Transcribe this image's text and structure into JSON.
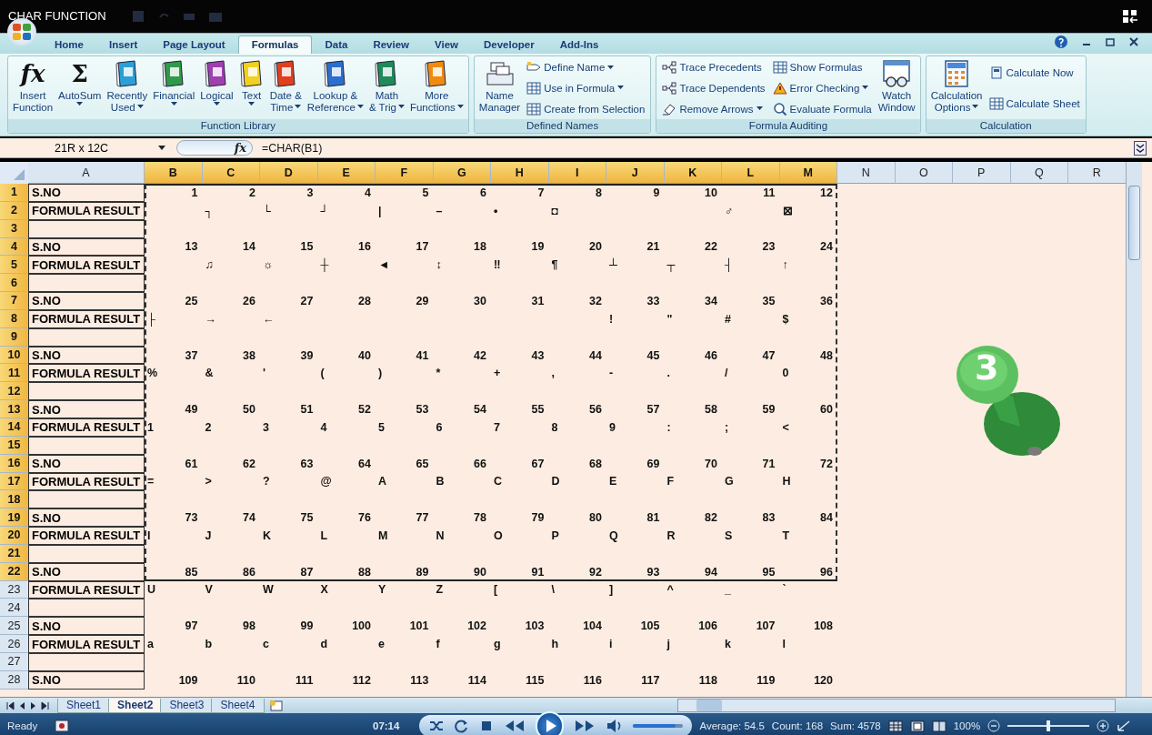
{
  "window": {
    "title": "CHAR FUNCTION"
  },
  "ribbon": {
    "tabs": [
      {
        "label": "Home",
        "selected": false
      },
      {
        "label": "Insert",
        "selected": false
      },
      {
        "label": "Page Layout",
        "selected": false
      },
      {
        "label": "Formulas",
        "selected": true
      },
      {
        "label": "Data",
        "selected": false
      },
      {
        "label": "Review",
        "selected": false
      },
      {
        "label": "View",
        "selected": false
      },
      {
        "label": "Developer",
        "selected": false
      },
      {
        "label": "Add-Ins",
        "selected": false
      }
    ],
    "groups": [
      {
        "label": "Function Library",
        "items": [
          {
            "kind": "large",
            "glyph": "fx",
            "lines": [
              "Insert",
              "Function"
            ],
            "dropdown": false
          },
          {
            "kind": "large",
            "glyph": "Σ",
            "lines": [
              "AutoSum"
            ],
            "dropdown": true
          },
          {
            "kind": "large",
            "lines": [
              "Recently",
              "Used"
            ],
            "dropdown": true
          },
          {
            "kind": "large",
            "lines": [
              "Financial"
            ],
            "dropdown": true
          },
          {
            "kind": "large",
            "lines": [
              "Logical"
            ],
            "dropdown": true
          },
          {
            "kind": "large",
            "lines": [
              "Text"
            ],
            "dropdown": true
          },
          {
            "kind": "large",
            "lines": [
              "Date &",
              "Time"
            ],
            "dropdown": true
          },
          {
            "kind": "large",
            "lines": [
              "Lookup &",
              "Reference"
            ],
            "dropdown": true
          },
          {
            "kind": "large",
            "lines": [
              "Math",
              "& Trig"
            ],
            "dropdown": true
          },
          {
            "kind": "large",
            "lines": [
              "More",
              "Functions"
            ],
            "dropdown": true
          }
        ]
      },
      {
        "label": "Defined Names",
        "items": [
          {
            "kind": "large",
            "lines": [
              "Name",
              "Manager"
            ],
            "dropdown": false
          },
          {
            "kind": "stack",
            "items": [
              {
                "label": "Define Name",
                "dropdown": true
              },
              {
                "label": "Use in Formula",
                "dropdown": true
              },
              {
                "label": "Create from Selection",
                "dropdown": false
              }
            ]
          }
        ]
      },
      {
        "label": "Formula Auditing",
        "items": [
          {
            "kind": "stack",
            "items": [
              {
                "label": "Trace Precedents",
                "dropdown": false
              },
              {
                "label": "Trace Dependents",
                "dropdown": false
              },
              {
                "label": "Remove Arrows",
                "dropdown": true
              }
            ]
          },
          {
            "kind": "stack",
            "items": [
              {
                "label": "Show Formulas",
                "dropdown": false
              },
              {
                "label": "Error Checking",
                "dropdown": true
              },
              {
                "label": "Evaluate Formula",
                "dropdown": false
              }
            ]
          },
          {
            "kind": "large",
            "lines": [
              "Watch",
              "Window"
            ],
            "dropdown": false
          }
        ]
      },
      {
        "label": "Calculation",
        "items": [
          {
            "kind": "large",
            "lines": [
              "Calculation",
              "Options"
            ],
            "dropdown": true
          },
          {
            "kind": "stack",
            "items": [
              {
                "label": "Calculate Now",
                "dropdown": false
              },
              {
                "label": "Calculate Sheet",
                "dropdown": false
              }
            ]
          }
        ]
      }
    ]
  },
  "formula_bar": {
    "name_box": "21R x 12C",
    "function_label": "fx",
    "formula": "=CHAR(B1)"
  },
  "sheet": {
    "columns": [
      {
        "label": "A",
        "selected": false
      },
      {
        "label": "B",
        "selected": true
      },
      {
        "label": "C",
        "selected": true
      },
      {
        "label": "D",
        "selected": true
      },
      {
        "label": "E",
        "selected": true
      },
      {
        "label": "F",
        "selected": true
      },
      {
        "label": "G",
        "selected": true
      },
      {
        "label": "H",
        "selected": true
      },
      {
        "label": "I",
        "selected": true
      },
      {
        "label": "J",
        "selected": true
      },
      {
        "label": "K",
        "selected": true
      },
      {
        "label": "L",
        "selected": true
      },
      {
        "label": "M",
        "selected": true
      },
      {
        "label": "N",
        "selected": false
      },
      {
        "label": "O",
        "selected": false
      },
      {
        "label": "P",
        "selected": false
      },
      {
        "label": "Q",
        "selected": false
      },
      {
        "label": "R",
        "selected": false
      }
    ],
    "rows": [
      {
        "header": "1",
        "selected": true,
        "kind": "number",
        "label": "S.NO",
        "values": [
          "1",
          "2",
          "3",
          "4",
          "5",
          "6",
          "7",
          "8",
          "9",
          "10",
          "11",
          "12"
        ]
      },
      {
        "header": "2",
        "selected": true,
        "kind": "result",
        "label": "FORMULA RESULT",
        "cells": [
          {
            "kind": "blank"
          },
          {
            "kind": "char",
            "value": "┐"
          },
          {
            "kind": "char",
            "value": "└"
          },
          {
            "kind": "char",
            "value": "┘"
          },
          {
            "kind": "char",
            "value": "|"
          },
          {
            "kind": "char",
            "value": "–"
          },
          {
            "kind": "char",
            "value": "•"
          },
          {
            "kind": "char",
            "value": "◘"
          },
          {
            "kind": "blank"
          },
          {
            "kind": "blank"
          },
          {
            "kind": "char",
            "value": "♂"
          },
          {
            "kind": "char",
            "value": "⊠"
          }
        ]
      },
      {
        "header": "3",
        "selected": true,
        "kind": "blank"
      },
      {
        "header": "4",
        "selected": true,
        "kind": "number",
        "label": "S.NO",
        "values": [
          "13",
          "14",
          "15",
          "16",
          "17",
          "18",
          "19",
          "20",
          "21",
          "22",
          "23",
          "24"
        ]
      },
      {
        "header": "5",
        "selected": true,
        "kind": "result",
        "label": "FORMULA RESULT",
        "cells": [
          {
            "kind": "blank"
          },
          {
            "kind": "char",
            "value": "♫"
          },
          {
            "kind": "char",
            "value": "☼"
          },
          {
            "kind": "char",
            "value": "┼"
          },
          {
            "kind": "char",
            "value": "◄"
          },
          {
            "kind": "char",
            "value": "↕"
          },
          {
            "kind": "char",
            "value": "‼"
          },
          {
            "kind": "char",
            "value": "¶"
          },
          {
            "kind": "char",
            "value": "┴"
          },
          {
            "kind": "char",
            "value": "┬"
          },
          {
            "kind": "char",
            "value": "┤"
          },
          {
            "kind": "char",
            "value": "↑"
          }
        ]
      },
      {
        "header": "6",
        "selected": true,
        "kind": "blank"
      },
      {
        "header": "7",
        "selected": true,
        "kind": "number",
        "label": "S.NO",
        "values": [
          "25",
          "26",
          "27",
          "28",
          "29",
          "30",
          "31",
          "32",
          "33",
          "34",
          "35",
          "36"
        ]
      },
      {
        "header": "8",
        "selected": true,
        "kind": "result",
        "label": "FORMULA RESULT",
        "cells": [
          {
            "kind": "char",
            "value": "├"
          },
          {
            "kind": "char",
            "value": "→"
          },
          {
            "kind": "char",
            "value": "←"
          },
          {
            "kind": "blank"
          },
          {
            "kind": "blank"
          },
          {
            "kind": "blank"
          },
          {
            "kind": "blank"
          },
          {
            "kind": "blank"
          },
          {
            "kind": "char",
            "value": "!"
          },
          {
            "kind": "char",
            "value": "\""
          },
          {
            "kind": "char",
            "value": "#"
          },
          {
            "kind": "char",
            "value": "$"
          }
        ]
      },
      {
        "header": "9",
        "selected": true,
        "kind": "blank"
      },
      {
        "header": "10",
        "selected": true,
        "kind": "number",
        "label": "S.NO",
        "values": [
          "37",
          "38",
          "39",
          "40",
          "41",
          "42",
          "43",
          "44",
          "45",
          "46",
          "47",
          "48"
        ]
      },
      {
        "header": "11",
        "selected": true,
        "kind": "result",
        "label": "FORMULA RESULT",
        "values": [
          "%",
          "&",
          "'",
          "(",
          ")",
          "*",
          "+",
          ",",
          "-",
          ".",
          "/",
          "0"
        ]
      },
      {
        "header": "12",
        "selected": true,
        "kind": "blank"
      },
      {
        "header": "13",
        "selected": true,
        "kind": "number",
        "label": "S.NO",
        "values": [
          "49",
          "50",
          "51",
          "52",
          "53",
          "54",
          "55",
          "56",
          "57",
          "58",
          "59",
          "60"
        ]
      },
      {
        "header": "14",
        "selected": true,
        "kind": "result",
        "label": "FORMULA RESULT",
        "values": [
          "1",
          "2",
          "3",
          "4",
          "5",
          "6",
          "7",
          "8",
          "9",
          ":",
          ";",
          "<"
        ]
      },
      {
        "header": "15",
        "selected": true,
        "kind": "blank"
      },
      {
        "header": "16",
        "selected": true,
        "kind": "number",
        "label": "S.NO",
        "values": [
          "61",
          "62",
          "63",
          "64",
          "65",
          "66",
          "67",
          "68",
          "69",
          "70",
          "71",
          "72"
        ]
      },
      {
        "header": "17",
        "selected": true,
        "kind": "result",
        "label": "FORMULA RESULT",
        "values": [
          "=",
          ">",
          "?",
          "@",
          "A",
          "B",
          "C",
          "D",
          "E",
          "F",
          "G",
          "H"
        ]
      },
      {
        "header": "18",
        "selected": true,
        "kind": "blank"
      },
      {
        "header": "19",
        "selected": true,
        "kind": "number",
        "label": "S.NO",
        "values": [
          "73",
          "74",
          "75",
          "76",
          "77",
          "78",
          "79",
          "80",
          "81",
          "82",
          "83",
          "84"
        ]
      },
      {
        "header": "20",
        "selected": true,
        "kind": "result",
        "label": "FORMULA RESULT",
        "values": [
          "I",
          "J",
          "K",
          "L",
          "M",
          "N",
          "O",
          "P",
          "Q",
          "R",
          "S",
          "T"
        ]
      },
      {
        "header": "21",
        "selected": true,
        "kind": "blank"
      },
      {
        "header": "22",
        "selected": true,
        "kind": "number",
        "label": "S.NO",
        "values": [
          "85",
          "86",
          "87",
          "88",
          "89",
          "90",
          "91",
          "92",
          "93",
          "94",
          "95",
          "96"
        ]
      },
      {
        "header": "23",
        "selected": false,
        "kind": "result",
        "label": "FORMULA RESULT",
        "values": [
          "U",
          "V",
          "W",
          "X",
          "Y",
          "Z",
          "[",
          "\\",
          "]",
          "^",
          "_",
          "`"
        ]
      },
      {
        "header": "24",
        "selected": false,
        "kind": "blank"
      },
      {
        "header": "25",
        "selected": false,
        "kind": "number",
        "label": "S.NO",
        "values": [
          "97",
          "98",
          "99",
          "100",
          "101",
          "102",
          "103",
          "104",
          "105",
          "106",
          "107",
          "108"
        ]
      },
      {
        "header": "26",
        "selected": false,
        "kind": "result",
        "label": "FORMULA RESULT",
        "values": [
          "a",
          "b",
          "c",
          "d",
          "e",
          "f",
          "g",
          "h",
          "i",
          "j",
          "k",
          "l"
        ]
      },
      {
        "header": "27",
        "selected": false,
        "kind": "blank"
      },
      {
        "header": "28",
        "selected": false,
        "kind": "number",
        "label": "S.NO",
        "values": [
          "109",
          "110",
          "111",
          "112",
          "113",
          "114",
          "115",
          "116",
          "117",
          "118",
          "119",
          "120"
        ]
      }
    ]
  },
  "pin_badge": {
    "label": "3"
  },
  "sheet_tabs": [
    {
      "label": "Sheet1",
      "selected": false
    },
    {
      "label": "Sheet2",
      "selected": true
    },
    {
      "label": "Sheet3",
      "selected": false
    },
    {
      "label": "Sheet4",
      "selected": false
    }
  ],
  "player": {
    "time": "07:14",
    "volume": {
      "level": 0.85
    }
  },
  "status_bar": {
    "mode": "Ready",
    "average": "Average: 54.5",
    "count": "Count: 168",
    "sum": "Sum: 4578",
    "zoom": "100%",
    "zoom_slider": {
      "level": 0.5
    }
  }
}
